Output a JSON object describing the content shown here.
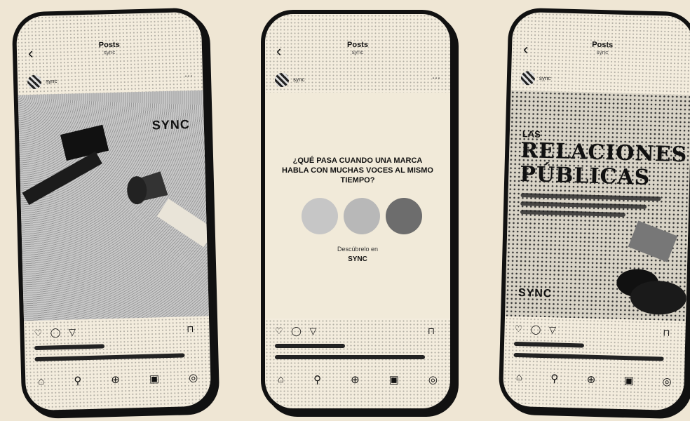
{
  "phones": [
    {
      "header_title": "Posts",
      "header_sub": "sync",
      "brand": "SYNC",
      "nav": [
        "home-icon",
        "search-icon",
        "add-icon",
        "reels-icon",
        "profile-icon"
      ]
    },
    {
      "header_title": "Posts",
      "header_sub": "sync",
      "question": "¿QUÉ PASA CUANDO UNA MARCA HABLA CON MUCHAS VOCES AL MISMO TIEMPO?",
      "discover": "Descúbrelo en",
      "brand": "SYNC"
    },
    {
      "header_title": "Posts",
      "header_sub": "sync",
      "kicker": "LAS",
      "title_line1": "RELACIONES",
      "title_line2": "PÚBLICAS",
      "brand": "SYNC"
    }
  ],
  "icons": {
    "like": "♡",
    "comment": "◯",
    "share": "▽",
    "save": "⊓",
    "back": "‹"
  }
}
